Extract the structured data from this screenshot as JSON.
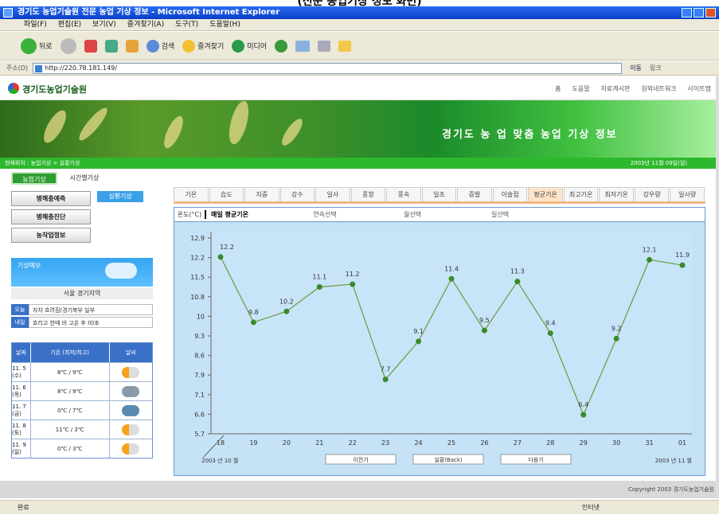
{
  "caption": "(선문 농업기상 정보 화면)",
  "window": {
    "title": "경기도 농업기술원 전문 농업 기상 정보 - Microsoft Internet Explorer"
  },
  "menu": [
    "파일(F)",
    "편집(E)",
    "보기(V)",
    "즐겨찾기(A)",
    "도구(T)",
    "도움말(H)"
  ],
  "toolbar": {
    "back": "뒤로",
    "search": "검색",
    "favorites": "즐겨찾기",
    "media": "미디어"
  },
  "address": {
    "label": "주소(D)",
    "url": "http://220.78.181.149/",
    "go": "이동",
    "links": "링크"
  },
  "site": {
    "logo": "경기도농업기술원",
    "topnav": [
      "홈",
      "도움말",
      "자료게시판",
      "원외네트워크",
      "사이트맵"
    ],
    "banner_title": "경기도 농 업 맞춤 농업 기상 정보",
    "breadcrumb": "현재위치 : 농업기상 > 실황기상",
    "date": "2003년 11월 09일(일)"
  },
  "sidebar": {
    "tab_active": "농업기상",
    "tab_other": "시간별기상",
    "buttons": [
      "병해충예측",
      "병해충진단",
      "농작업정보"
    ],
    "pill": "실황기상",
    "weather_banner": "기상예보",
    "weather_link": "서울 경기지역",
    "forecast": [
      {
        "k": "오늘",
        "v": "차차 흐려짐(경기북부 일부"
      },
      {
        "k": "내일",
        "v": "흐리고 한때 비 고온 후 비(B"
      }
    ],
    "table": {
      "headers": [
        "날짜",
        "기온 (최저/최고)",
        "날씨"
      ],
      "rows": [
        {
          "date": "11. 5 (수)",
          "temp": "8℃ / 9℃",
          "icon": "sun-cloud-icon"
        },
        {
          "date": "11. 6 (목)",
          "temp": "8℃ / 9℃",
          "icon": "cloud-icon"
        },
        {
          "date": "11. 7 (금)",
          "temp": "0℃ / 7℃",
          "icon": "rain-icon"
        },
        {
          "date": "11. 8 (토)",
          "temp": "11℃ / 3℃",
          "icon": "sun-cloud-icon"
        },
        {
          "date": "11. 9 (일)",
          "temp": "0℃ / 3℃",
          "icon": "sun-cloud-icon"
        }
      ]
    }
  },
  "main": {
    "tabs": [
      "기온",
      "습도",
      "지중",
      "강수",
      "일사",
      "풍향",
      "풍속",
      "일조",
      "증발",
      "이슬점",
      "평균기온",
      "최고기온",
      "최저기온",
      "강우량",
      "일사량"
    ],
    "selected_tab": 10,
    "chart_header": {
      "label": "온도(°C)",
      "current": "매일 평균기온",
      "options": [
        "연속선택",
        "월선택",
        "일선택"
      ]
    },
    "bottom": {
      "start": "2003 년 10 월",
      "prev": "이전기",
      "mid": "실황(Back)",
      "next": "다음기",
      "end": "2003 년 11 월"
    }
  },
  "chart_data": {
    "type": "line",
    "x": [
      "18",
      "19",
      "20",
      "21",
      "22",
      "23",
      "24",
      "25",
      "26",
      "27",
      "28",
      "29",
      "30",
      "31",
      "01"
    ],
    "values": [
      12.2,
      9.8,
      10.2,
      11.1,
      11.2,
      7.7,
      9.1,
      11.4,
      9.5,
      11.3,
      9.4,
      6.4,
      9.2,
      12.1,
      11.9
    ],
    "yticks": [
      "5.7",
      "6.6",
      "7.1",
      "7.9",
      "8.6",
      "9.3",
      "10",
      "10.8",
      "11.5",
      "12.2",
      "12.9"
    ],
    "ylim": [
      5.7,
      12.9
    ],
    "xlabel_left": "2003 년 10 월",
    "xlabel_right": "2003 년 11 월",
    "line_color": "#6b9a3a",
    "grid": false
  },
  "footer": {
    "copyright": "Copyright 2003 경기도농업기술원"
  },
  "status": {
    "left": "완료",
    "zone": "인터넷"
  }
}
